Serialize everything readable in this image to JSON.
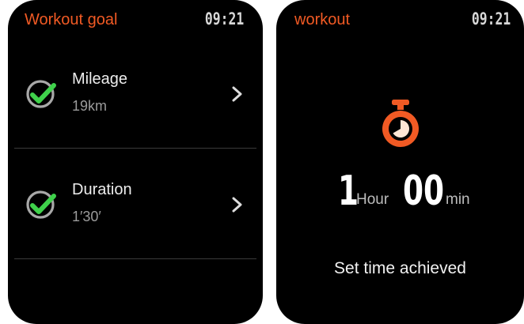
{
  "left_screen": {
    "title": "Workout goal",
    "time": "09:21",
    "goals": [
      {
        "label": "Mileage",
        "value": "19km",
        "checked": true
      },
      {
        "label": "Duration",
        "value": "1′30′",
        "checked": true
      }
    ]
  },
  "right_screen": {
    "title": "workout",
    "time": "09:21",
    "duration": {
      "hours": "1",
      "hour_unit": "Hour",
      "minutes": "00",
      "minute_unit": "min"
    },
    "status_text": "Set time achieved"
  },
  "icons": {
    "goal_check": "check-circle-icon",
    "goal_arrow": "chevron-right-icon",
    "timer": "stopwatch-icon"
  },
  "colors": {
    "accent": "#f15a24",
    "check_green": "#3fd14b",
    "screen_background": "#000000"
  }
}
